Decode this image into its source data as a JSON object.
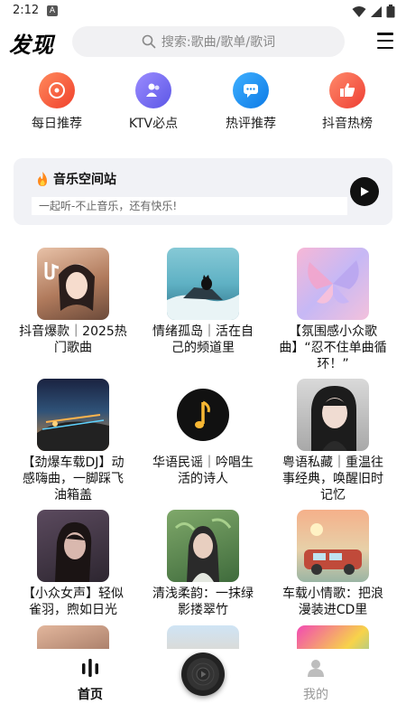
{
  "status_bar": {
    "time": "2:12",
    "notification_letter": "A"
  },
  "header": {
    "logo": "发现",
    "search_placeholder": "搜索:歌曲/歌单/歌词"
  },
  "quick_nav": [
    {
      "label": "每日推荐",
      "icon": "disc-icon",
      "color": "#f25a3b"
    },
    {
      "label": "KTV必点",
      "icon": "users-icon",
      "color": "#7a6cf0"
    },
    {
      "label": "热评推荐",
      "icon": "chat-icon",
      "color": "#1c8ff0"
    },
    {
      "label": "抖音热榜",
      "icon": "thumbs-up-icon",
      "color": "#f0533b"
    }
  ],
  "radio": {
    "title": "音乐空间站",
    "subtitle": "一起听-不止音乐，还有快乐!"
  },
  "playlists": [
    {
      "title": "抖音爆款｜2025热门歌曲"
    },
    {
      "title": "情绪孤岛｜活在自己的频道里"
    },
    {
      "title": "【氛围感小众歌曲】“忍不住单曲循环！”"
    },
    {
      "title": "【劲爆车载DJ】动感嗨曲，一脚踩飞油箱盖"
    },
    {
      "title": "华语民谣｜吟唱生活的诗人"
    },
    {
      "title": "粤语私藏｜重温往事经典，唤醒旧时记忆"
    },
    {
      "title": "【小众女声】轻似雀羽，煦如日光"
    },
    {
      "title": "清浅柔韵：一抹绿影搂翠竹"
    },
    {
      "title": "车载小情歌：把浪漫装进CD里"
    }
  ],
  "bottom_nav": {
    "home": "首页",
    "mine": "我的"
  },
  "colors": {
    "accent": "#111111",
    "muted": "#aaaaaa"
  }
}
